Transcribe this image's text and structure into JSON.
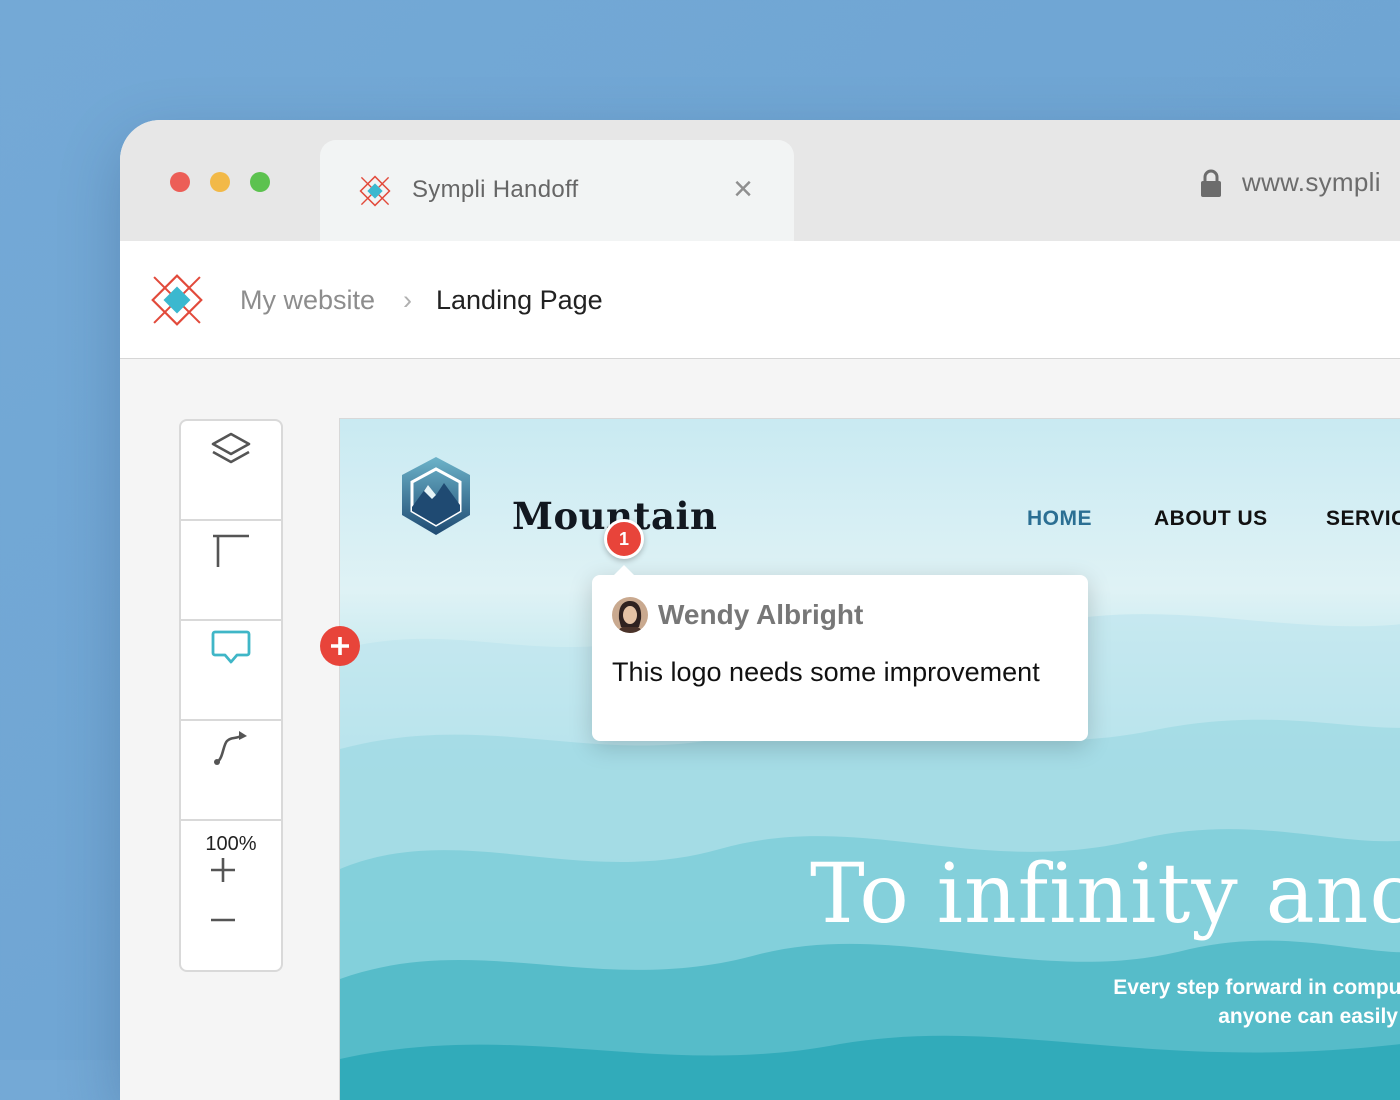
{
  "browser": {
    "tab_title": "Sympli Handoff",
    "tab_close": "×",
    "url": "www.sympli"
  },
  "app": {
    "breadcrumb": {
      "parent": "My website",
      "separator": "›",
      "current": "Landing Page"
    }
  },
  "toolbar": {
    "zoom_level": "100%"
  },
  "mockup": {
    "brand": "Mountain",
    "nav": [
      "HOME",
      "ABOUT US",
      "SERVIC"
    ],
    "active_nav": "HOME",
    "hero_title": "To infinity anc",
    "hero_subtitle_line1": "Every step forward in computing",
    "hero_subtitle_line2": "anyone can easily use"
  },
  "comment": {
    "pin_number": "1",
    "author": "Wendy Albright",
    "text": "This logo needs some improvement"
  },
  "colors": {
    "accent_red": "#e8443a",
    "accent_teal": "#3fb6c7",
    "nav_active": "#2b6f93",
    "brand_red": "#e24a3b",
    "brand_teal": "#3bb8cf"
  }
}
